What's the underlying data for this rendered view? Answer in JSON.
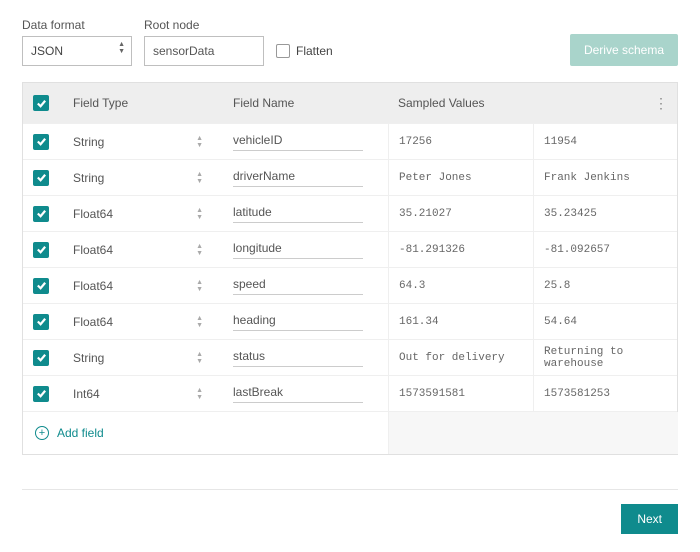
{
  "top": {
    "dataFormatLabel": "Data format",
    "dataFormatValue": "JSON",
    "rootNodeLabel": "Root node",
    "rootNodeValue": "sensorData",
    "flattenLabel": "Flatten",
    "deriveLabel": "Derive schema"
  },
  "columns": {
    "fieldType": "Field Type",
    "fieldName": "Field Name",
    "sampled": "Sampled Values"
  },
  "rows": [
    {
      "type": "String",
      "name": "vehicleID",
      "s1": "17256",
      "s2": "11954"
    },
    {
      "type": "String",
      "name": "driverName",
      "s1": "Peter Jones",
      "s2": "Frank Jenkins"
    },
    {
      "type": "Float64",
      "name": "latitude",
      "s1": "35.21027",
      "s2": "35.23425"
    },
    {
      "type": "Float64",
      "name": "longitude",
      "s1": "-81.291326",
      "s2": "-81.092657"
    },
    {
      "type": "Float64",
      "name": "speed",
      "s1": "64.3",
      "s2": "25.8"
    },
    {
      "type": "Float64",
      "name": "heading",
      "s1": "161.34",
      "s2": "54.64"
    },
    {
      "type": "String",
      "name": "status",
      "s1": "Out for delivery",
      "s2": "Returning to warehouse"
    },
    {
      "type": "Int64",
      "name": "lastBreak",
      "s1": "1573591581",
      "s2": "1573581253"
    }
  ],
  "addField": "Add field",
  "nextLabel": "Next"
}
